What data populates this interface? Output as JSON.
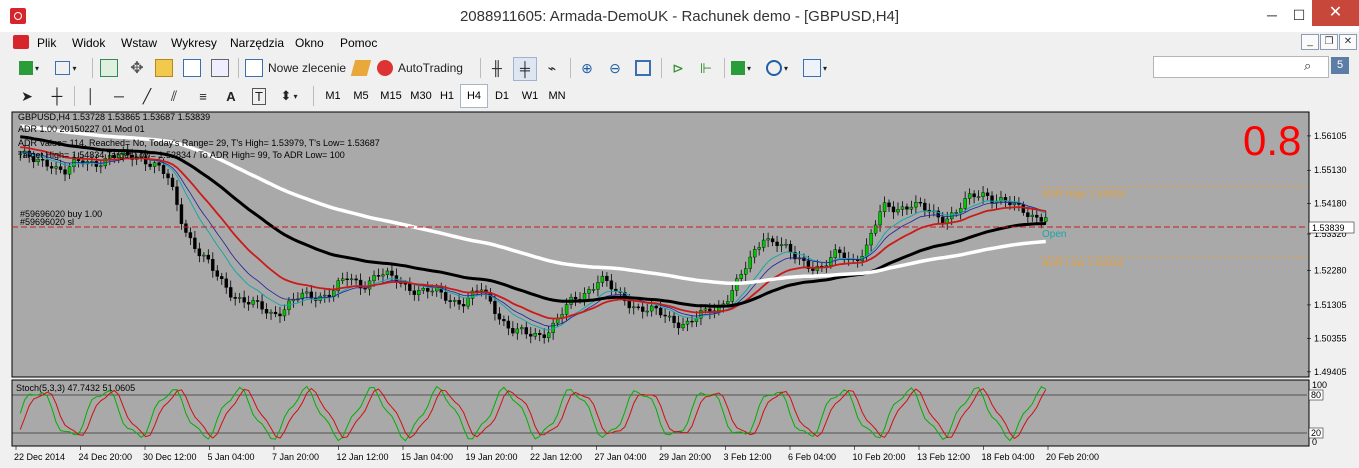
{
  "window": {
    "title": "2088911605: Armada-DemoUK - Rachunek demo - [GBPUSD,H4]",
    "minimize": "─",
    "maximize": "☐",
    "close": "✕"
  },
  "menu": [
    "Plik",
    "Widok",
    "Wstaw",
    "Wykresy",
    "Narzędzia",
    "Okno",
    "Pomoc"
  ],
  "toolbar": {
    "new_order": "Nowe zlecenie",
    "autotrading": "AutoTrading"
  },
  "timeframes": [
    "M1",
    "M5",
    "M15",
    "M30",
    "H1",
    "H4",
    "D1",
    "W1",
    "MN"
  ],
  "active_timeframe": "H4",
  "search": {
    "placeholder": ""
  },
  "messages_badge": "5",
  "chart": {
    "header": "GBPUSD,H4  1.53728 1.53865 1.53687 1.53839",
    "info_lines": [
      "ADR 1.00 20150227 01 Mod 01",
      "ADR Value= 114, Reached= No, Today's Range= 29, T's High= 1.53979, T's Low= 1.53687",
      "Target High= 1.54834 Target Low= 1.52834 / To ADR High= 99, To ADR Low= 100"
    ],
    "order_lines": [
      "#59696020 buy 1.00",
      "#59696020 sl"
    ],
    "big_value": "0.8",
    "adr_high_label": "ADR High  1.54834",
    "adr_low_label": "ADR Low  1.52834",
    "open_label": "Open",
    "price_labels": [
      "1.56105",
      "1.55130",
      "1.54180",
      "1.53320",
      "1.52280",
      "1.51305",
      "1.50355",
      "1.49405"
    ],
    "current_price": "1.53839",
    "stoch_header": "Stoch(5,3,3) 47.7432 51.0605",
    "stoch_levels": [
      "100",
      "80",
      "20",
      "0"
    ],
    "time_labels": [
      "22 Dec 2014",
      "24 Dec 20:00",
      "30 Dec 12:00",
      "5 Jan 04:00",
      "7 Jan 20:00",
      "12 Jan 12:00",
      "15 Jan 04:00",
      "19 Jan 20:00",
      "22 Jan 12:00",
      "27 Jan 04:00",
      "29 Jan 20:00",
      "3 Feb 12:00",
      "6 Feb 04:00",
      "10 Feb 20:00",
      "13 Feb 12:00",
      "18 Feb 04:00",
      "20 Feb 20:00"
    ],
    "colors": {
      "background": "#a9a9a9",
      "bull": "#00c800",
      "bear": "#000000",
      "ma_fast": "#1aa6a6",
      "ma_mid": "#cc1a1a",
      "ma_slow": "#000000",
      "ma_white": "#ffffff",
      "adr": "#e0a040",
      "big_value": "#ff0000",
      "stoch_main": "#00b000",
      "stoch_signal": "#d01010"
    }
  },
  "chart_data": {
    "type": "candlestick",
    "symbol": "GBPUSD",
    "timeframe": "H4",
    "y_range": [
      1.494,
      1.565
    ],
    "close_path": [
      1.556,
      1.553,
      1.554,
      1.551,
      1.553,
      1.554,
      1.555,
      1.5545,
      1.556,
      1.553,
      1.548,
      1.536,
      1.528,
      1.522,
      1.518,
      1.514,
      1.512,
      1.511,
      1.513,
      1.515,
      1.516,
      1.517,
      1.52,
      1.519,
      1.522,
      1.52,
      1.519,
      1.517,
      1.516,
      1.515,
      1.514,
      1.517,
      1.512,
      1.506,
      1.504,
      1.505,
      1.508,
      1.513,
      1.517,
      1.521,
      1.516,
      1.514,
      1.512,
      1.51,
      1.509,
      1.508,
      1.51,
      1.513,
      1.518,
      1.524,
      1.533,
      1.531,
      1.526,
      1.525,
      1.524,
      1.527,
      1.526,
      1.53,
      1.54,
      1.541,
      1.542,
      1.539,
      1.538,
      1.54,
      1.543,
      1.545,
      1.543,
      1.54,
      1.539,
      1.5384
    ]
  }
}
